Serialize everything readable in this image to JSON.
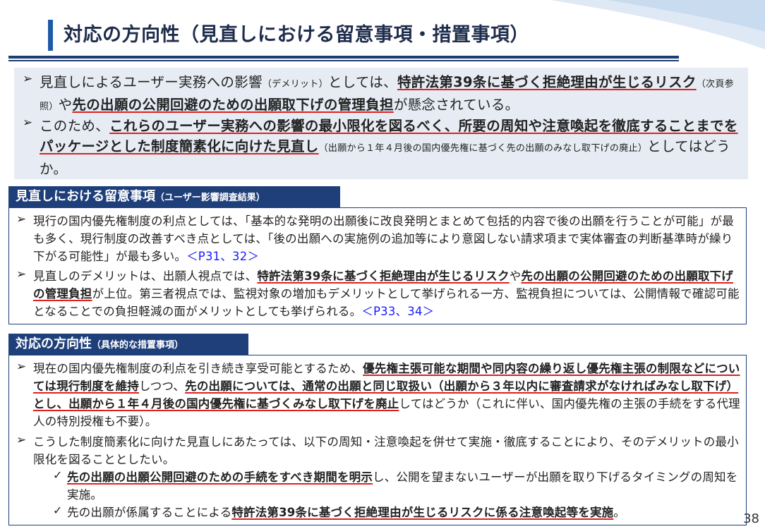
{
  "header": {
    "title": "対応の方向性（見直しにおける留意事項・措置事項）"
  },
  "summary": {
    "bullet_symbol": "➢",
    "item1": {
      "t1": "見直しによるユーザー実務への影響",
      "t2": "（デメリット）",
      "t3": "としては、",
      "t4": "特許法第39条に基づく拒絶理由が生じるリスク",
      "t5": "（次頁参照）",
      "t6": "や",
      "t7": "先の出願の公開回避のための出願取下げの管理負担",
      "t8": "が懸念されている。"
    },
    "item2": {
      "t1": "このため、",
      "t2": "これらのユーザー実務への影響の最小限化を図るべく、所要の周知や注意喚起を徹底することまでをパッケージとした制度簡素化に向けた見直し",
      "t3": "（出願から１年４月後の国内優先権に基づく先の出願のみなし取下げの廃止）",
      "t4": "としてはどうか。"
    }
  },
  "section1": {
    "tab_title": "見直しにおける留意事項",
    "tab_sub": "（ユーザー影響調査結果）",
    "item1": {
      "t1": "現行の国内優先権制度の利点としては、「基本的な発明の出願後に改良発明とまとめて包括的内容で後の出願を行うことが可能」が最も多く、現行制度の改善すべき点としては、「後の出願への実施例の追加等により意図しない請求項まで実体審査の判断基準時が繰り下がる可能性」が最も多い。",
      "ref": "＜P31、32＞"
    },
    "item2": {
      "t1": "見直しのデメリットは、出願人視点では、",
      "t2": "特許法第39条に基づく拒絶理由が生じるリスク",
      "t3": "や",
      "t4": "先の出願の公開回避のための出願取下げの管理負担",
      "t5": "が上位。第三者視点では、監視対象の増加もデメリットとして挙げられる一方、監視負担については、公開情報で確認可能となることでの負担軽減の面がメリットとしても挙げられる。",
      "ref": "＜P33、34＞"
    }
  },
  "section2": {
    "tab_title": "対応の方向性",
    "tab_sub": "（具体的な措置事項）",
    "item1": {
      "t1": "現在の国内優先権制度の利点を引き続き享受可能とするため、",
      "t2": "優先権主張可能な期間や同内容の繰り返し優先権主張の制限などについては現行制度を維持",
      "t3": "しつつ、",
      "t4": "先の出願については、通常の出願と同じ取扱い（出願から３年以内に審査請求がなければみなし取下げ）とし、出願から１年４月後の国内優先権に基づくみなし取下げを廃止",
      "t5": "してはどうか（これに伴い、国内優先権の主張の手続をする代理人の特別授権も不要）。"
    },
    "item2": {
      "t1": "こうした制度簡素化に向けた見直しにあたっては、以下の周知・注意喚起を併せて実施・徹底することにより、そのデメリットの最小限化を図ることとしたい。"
    },
    "check_symbol": "✓",
    "check1": {
      "t1": "先の出願の出願公開回避のための手続をすべき期間を明示",
      "t2": "し、公開を望まないユーザーが出願を取り下げるタイミングの周知を実施。"
    },
    "check2": {
      "t1": "先の出願が係属することによる",
      "t2": "特許法第39条に基づく拒絶理由が生じるリスクに係る注意喚起等を実施",
      "t3": "。"
    }
  },
  "footer": {
    "page_number": "38"
  },
  "colors": {
    "navy": "#1e3f7a",
    "underline": "#e02020",
    "link": "#1a1aff",
    "summary_bg": "#e7ecf4"
  }
}
